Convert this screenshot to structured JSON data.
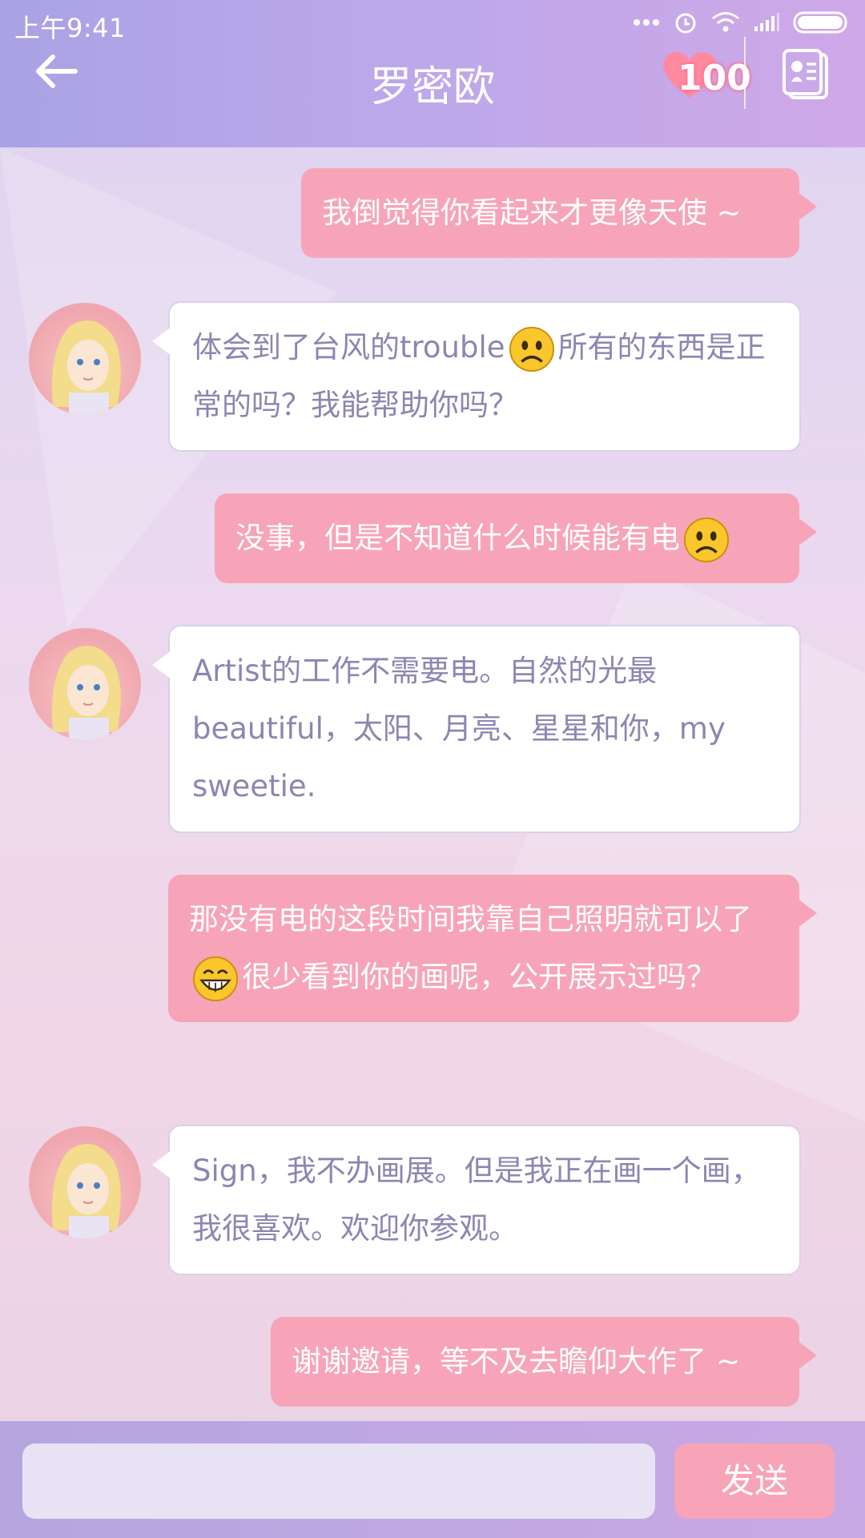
{
  "status_bar": {
    "time": "上午9:41",
    "icons": [
      "more-dots-icon",
      "alarm-icon",
      "wifi-icon",
      "signal-icon",
      "battery-icon"
    ]
  },
  "header": {
    "title": "罗密欧",
    "back_icon": "back-arrow-icon",
    "heart_count": "100",
    "contact_icon": "contact-card-icon"
  },
  "messages": [
    {
      "side": "out",
      "parts": [
        "我倒觉得你看起来才更像天使 ~"
      ]
    },
    {
      "side": "in",
      "parts": [
        "体会到了台风的trouble",
        "所有的东西是正常的吗？我能帮助你吗？"
      ],
      "emoji": "sad"
    },
    {
      "side": "out",
      "parts": [
        "没事，但是不知道什么时候能有电"
      ],
      "emoji": "sad"
    },
    {
      "side": "in",
      "parts": [
        "Artist的工作不需要电。自然的光最beautiful，太阳、月亮、星星和你，my sweetie."
      ]
    },
    {
      "side": "out",
      "parts": [
        "那没有电的这段时间我靠自己照明就可以了",
        "很少看到你的画呢，公开展示过吗？"
      ],
      "emoji": "grin"
    },
    {
      "side": "in",
      "parts": [
        "Sign，我不办画展。但是我正在画一个画，我很喜欢。欢迎你参观。"
      ]
    },
    {
      "side": "out",
      "parts": [
        "谢谢邀请，等不及去瞻仰大作了 ~"
      ]
    }
  ],
  "input": {
    "value": ""
  },
  "send_label": "发送",
  "colors": {
    "accent_pink": "#f7a4b8",
    "header_purple": "#b7a8ea",
    "incoming_text": "#8c86b2"
  }
}
